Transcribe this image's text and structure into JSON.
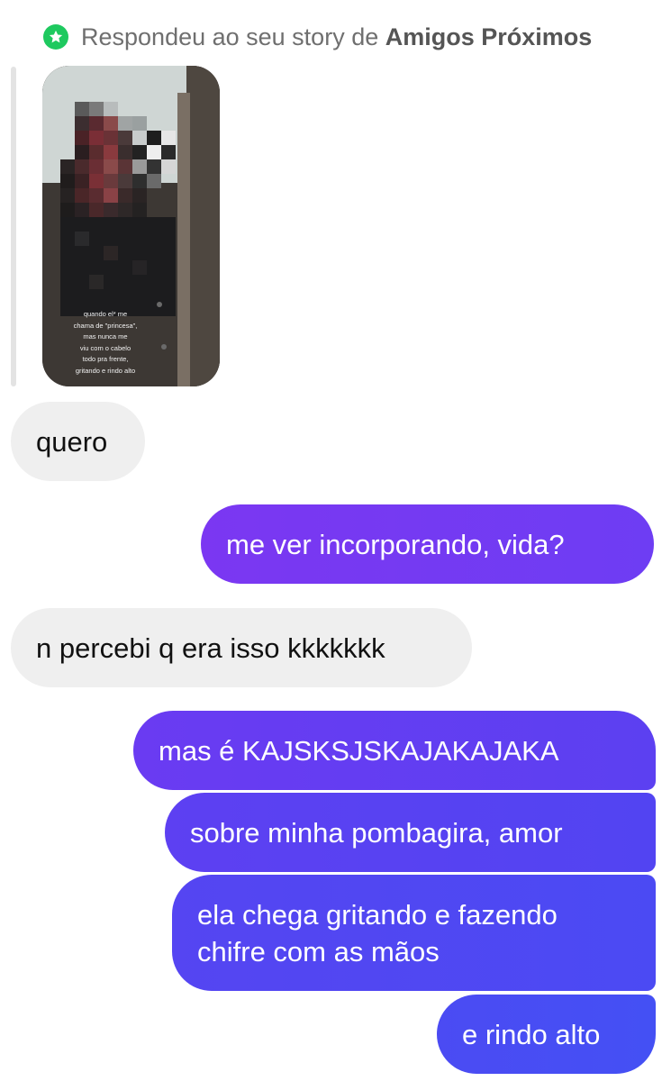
{
  "header": {
    "prefix": "Respondeu ao seu story de",
    "list_name": "Amigos Próximos",
    "icon": "star-icon",
    "icon_color": "#1ec95f"
  },
  "story": {
    "caption": "quando el* me\nchama de \"princesa\",\nmas nunca me\nviu com o cabelo\ntodo pra frente,\ngritando e rindo alto"
  },
  "messages": [
    {
      "direction": "received",
      "text": "quero"
    },
    {
      "direction": "sent",
      "text": "me ver incorporando, vida?"
    },
    {
      "direction": "received",
      "text": "n percebi q era isso kkkkkkk"
    },
    {
      "direction": "sent",
      "text": "mas é KAJSKSJSKAJAKAJAKA"
    },
    {
      "direction": "sent",
      "text": "sobre minha pombagira, amor"
    },
    {
      "direction": "sent",
      "text": "ela chega gritando e fazendo\nchifre com as mãos"
    },
    {
      "direction": "sent",
      "text": "e rindo alto"
    }
  ],
  "colors": {
    "sent_gradient_top": "#7b37f2",
    "sent_gradient_bottom": "#4450f4",
    "received_bubble": "#efefef",
    "header_text": "#6f6f6f"
  }
}
